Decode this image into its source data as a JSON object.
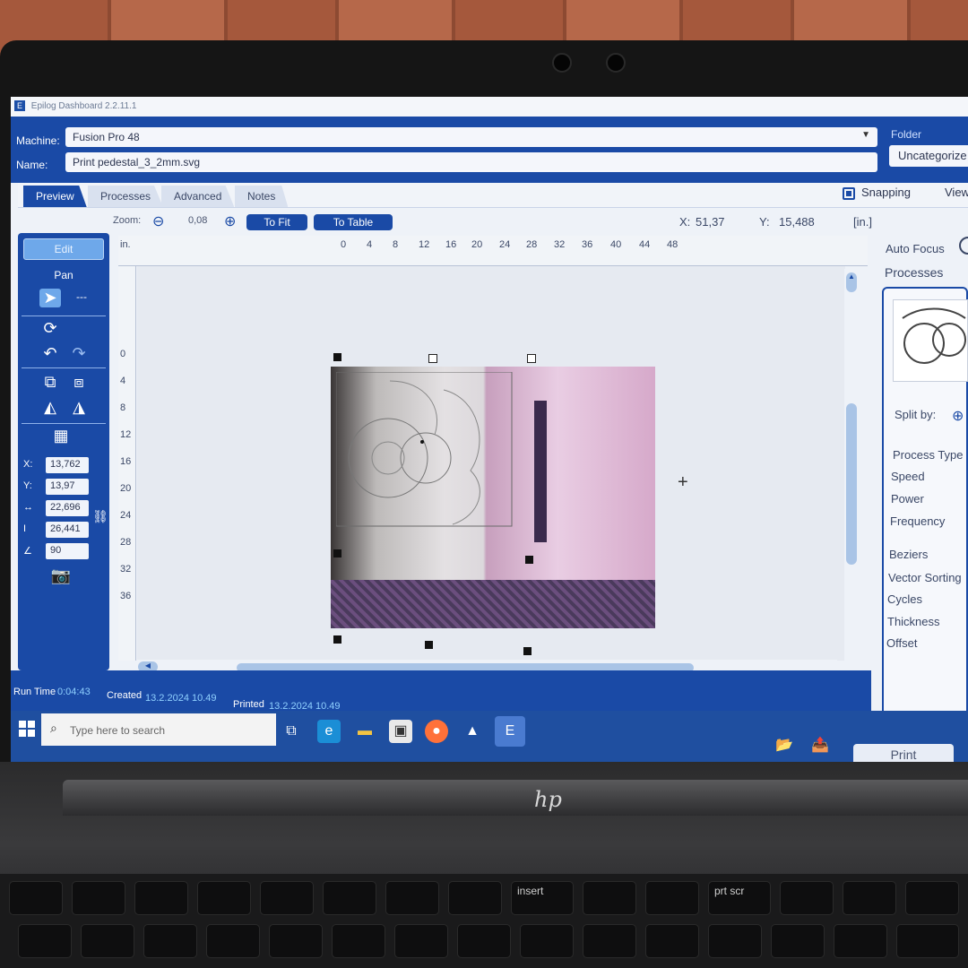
{
  "window": {
    "title": "Epilog Dashboard 2.2.11.1"
  },
  "header": {
    "machine_label": "Machine:",
    "machine_value": "Fusion Pro 48",
    "name_label": "Name:",
    "name_value": "Print pedestal_3_2mm.svg",
    "folder_label": "Folder",
    "folder_value": "Uncategorize"
  },
  "tabs": [
    {
      "label": "Preview",
      "active": true
    },
    {
      "label": "Processes"
    },
    {
      "label": "Advanced"
    },
    {
      "label": "Notes"
    }
  ],
  "options": {
    "snapping_label": "Snapping",
    "snapping_checked": true,
    "view_label": "View"
  },
  "zoom": {
    "label": "Zoom:",
    "value": "0,08",
    "to_fit": "To Fit",
    "to_table": "To Table"
  },
  "cursor": {
    "x_label": "X:",
    "x_value": "51,37",
    "y_label": "Y:",
    "y_value": "15,488",
    "units": "[in.]"
  },
  "tool_panel": {
    "edit_label": "Edit",
    "pan_label": "Pan",
    "cursor_dash": "---",
    "fields": [
      {
        "label": "X:",
        "value": "13,762"
      },
      {
        "label": "Y:",
        "value": "13,97"
      },
      {
        "label": "↔",
        "value": "22,696"
      },
      {
        "label": "I",
        "value": "26,441"
      },
      {
        "label": "∠",
        "value": "90"
      }
    ]
  },
  "ruler": {
    "unit": "in.",
    "top_ticks": [
      "0",
      "4",
      "8",
      "12",
      "16",
      "20",
      "24",
      "28",
      "32",
      "36",
      "40",
      "44",
      "48"
    ],
    "left_ticks": [
      "0",
      "4",
      "8",
      "12",
      "16",
      "20",
      "24",
      "28",
      "32",
      "36"
    ]
  },
  "right_panel": {
    "auto_focus": "Auto Focus",
    "processes_title": "Processes",
    "split_by": "Split by:",
    "params": [
      "Process Type",
      "Speed",
      "Power",
      "Frequency",
      "Beziers",
      "Vector Sorting",
      "Cycles",
      "Thickness",
      "Offset"
    ]
  },
  "status": {
    "run_time_label": "Run Time",
    "run_time_value": "0:04:43",
    "created_label": "Created",
    "created_value": "13.2.2024 10.49",
    "printed_label": "Printed",
    "printed_value": "13.2.2024 10.49"
  },
  "taskbar": {
    "search_placeholder": "Type here to search",
    "print_label": "Print"
  },
  "keyboard": {
    "insert_label": "insert",
    "prtscr_label": "prt scr"
  },
  "colors": {
    "primary_blue": "#1a4aa6",
    "light_blue": "#6ea8ea",
    "canvas_bg": "#e6eaf1"
  }
}
